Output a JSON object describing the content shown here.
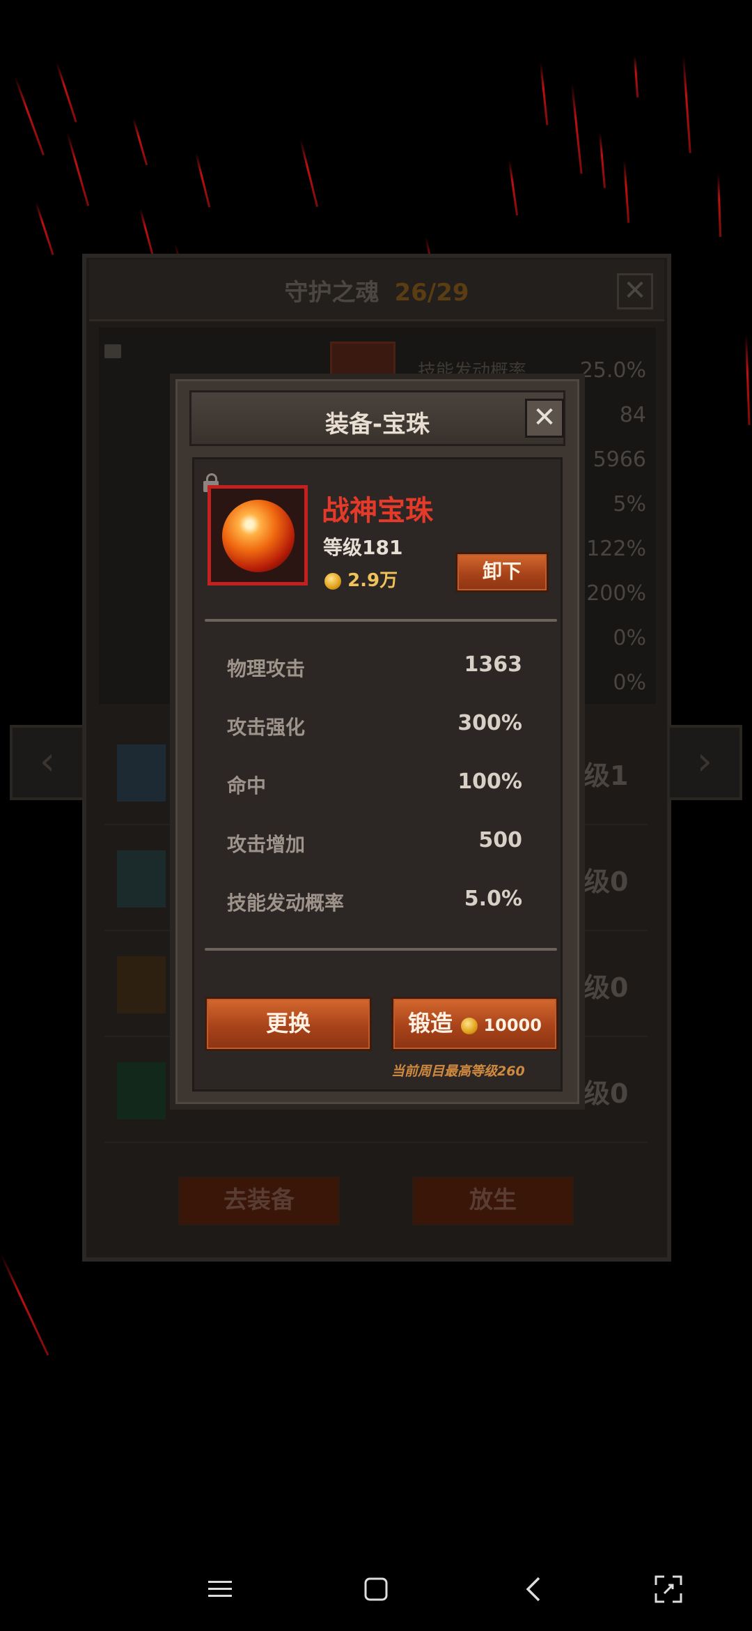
{
  "background": {
    "title": "守护之魂",
    "count": "26/29",
    "stats": [
      "25.0%",
      "84",
      "5966",
      "5%",
      "122%",
      "200%",
      "0%",
      "0%"
    ],
    "stat_row_label": "技能发动概率",
    "rows": [
      {
        "level": "级1"
      },
      {
        "level": "级0"
      },
      {
        "level": "级0"
      },
      {
        "level": "级0"
      }
    ],
    "buttons": {
      "equip": "去装备",
      "release": "放生"
    }
  },
  "dialog": {
    "title": "装备-宝珠",
    "close_icon": "close-icon",
    "item": {
      "name": "战神宝珠",
      "level": "等级181",
      "price": "2.9万"
    },
    "unequip_label": "卸下",
    "stats": [
      {
        "label": "物理攻击",
        "value": "1363"
      },
      {
        "label": "攻击强化",
        "value": "300%"
      },
      {
        "label": "命中",
        "value": "100%"
      },
      {
        "label": "攻击增加",
        "value": "500"
      },
      {
        "label": "技能发动概率",
        "value": "5.0%"
      }
    ],
    "replace_label": "更换",
    "forge_label": "锻造",
    "forge_cost": "10000",
    "note": "当前周目最高等级260"
  },
  "nav": {
    "icons": [
      "menu-icon",
      "home-icon",
      "back-icon",
      "screenshot-icon"
    ]
  },
  "colors": {
    "item_name": "#e53a2a",
    "accent_orange": "#a8431a",
    "coin": "#f0c35a"
  }
}
